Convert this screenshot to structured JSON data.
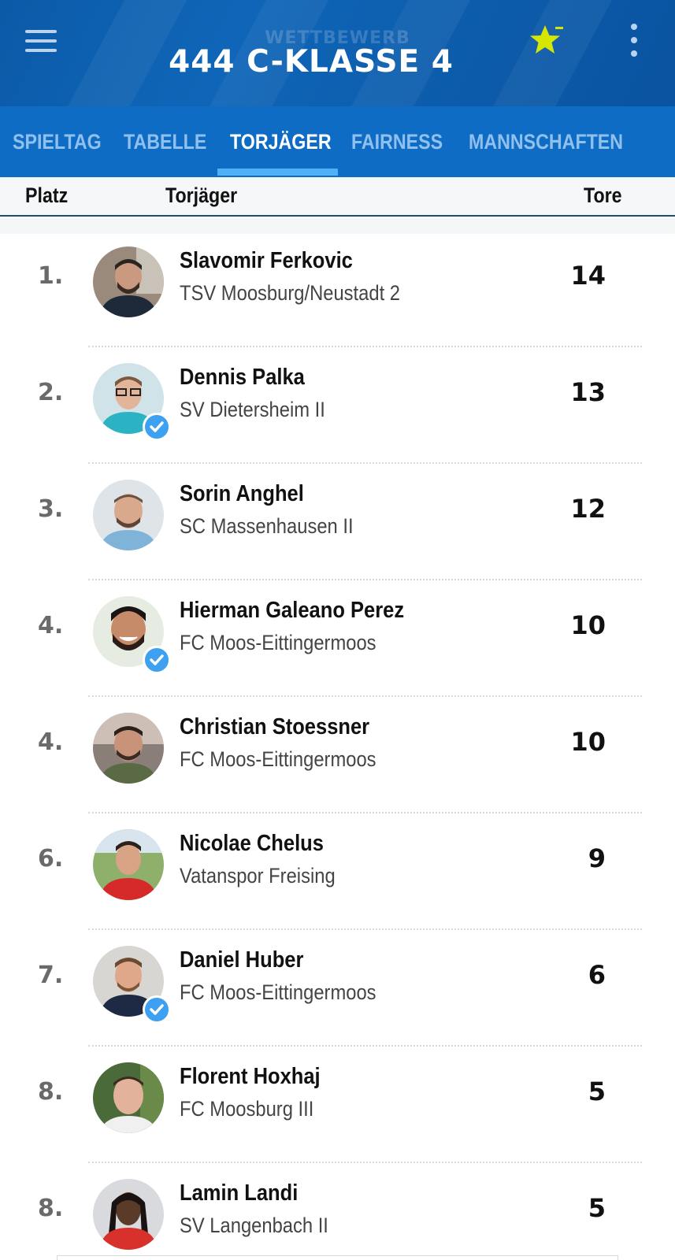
{
  "header": {
    "overline": "WETTBEWERB",
    "title": "444 C-KLASSE 4",
    "accent_color": "#d6e600"
  },
  "icons": {
    "menu": "hamburger-menu-icon",
    "favorite": "star-favorite-icon",
    "more": "more-vertical-icon"
  },
  "tabs": [
    {
      "label": "SPIELTAG",
      "active": false
    },
    {
      "label": "TABELLE",
      "active": false
    },
    {
      "label": "TORJÄGER",
      "active": true
    },
    {
      "label": "FAIRNESS",
      "active": false
    },
    {
      "label": "MANNSCHAFTEN",
      "active": false
    }
  ],
  "columns": {
    "rank": "Platz",
    "player": "Torjäger",
    "goals": "Tore"
  },
  "players": [
    {
      "rank": "1.",
      "name": "Slavomir Ferkovic",
      "club": "TSV Moosburg/Neustadt 2",
      "goals": "14",
      "verified": false
    },
    {
      "rank": "2.",
      "name": "Dennis Palka",
      "club": "SV Dietersheim II",
      "goals": "13",
      "verified": true
    },
    {
      "rank": "3.",
      "name": "Sorin Anghel",
      "club": "SC Massenhausen II",
      "goals": "12",
      "verified": false
    },
    {
      "rank": "4.",
      "name": "Hierman Galeano Perez",
      "club": "FC Moos-Eittingermoos",
      "goals": "10",
      "verified": true
    },
    {
      "rank": "4.",
      "name": "Christian Stoessner",
      "club": "FC Moos-Eittingermoos",
      "goals": "10",
      "verified": false
    },
    {
      "rank": "6.",
      "name": "Nicolae Chelus",
      "club": "Vatanspor Freising",
      "goals": "9",
      "verified": false
    },
    {
      "rank": "7.",
      "name": "Daniel Huber",
      "club": "FC Moos-Eittingermoos",
      "goals": "6",
      "verified": true
    },
    {
      "rank": "8.",
      "name": "Florent Hoxhaj",
      "club": "FC Moosburg III",
      "goals": "5",
      "verified": false
    },
    {
      "rank": "8.",
      "name": "Lamin Landi",
      "club": "SV Langenbach II",
      "goals": "5",
      "verified": false
    }
  ]
}
